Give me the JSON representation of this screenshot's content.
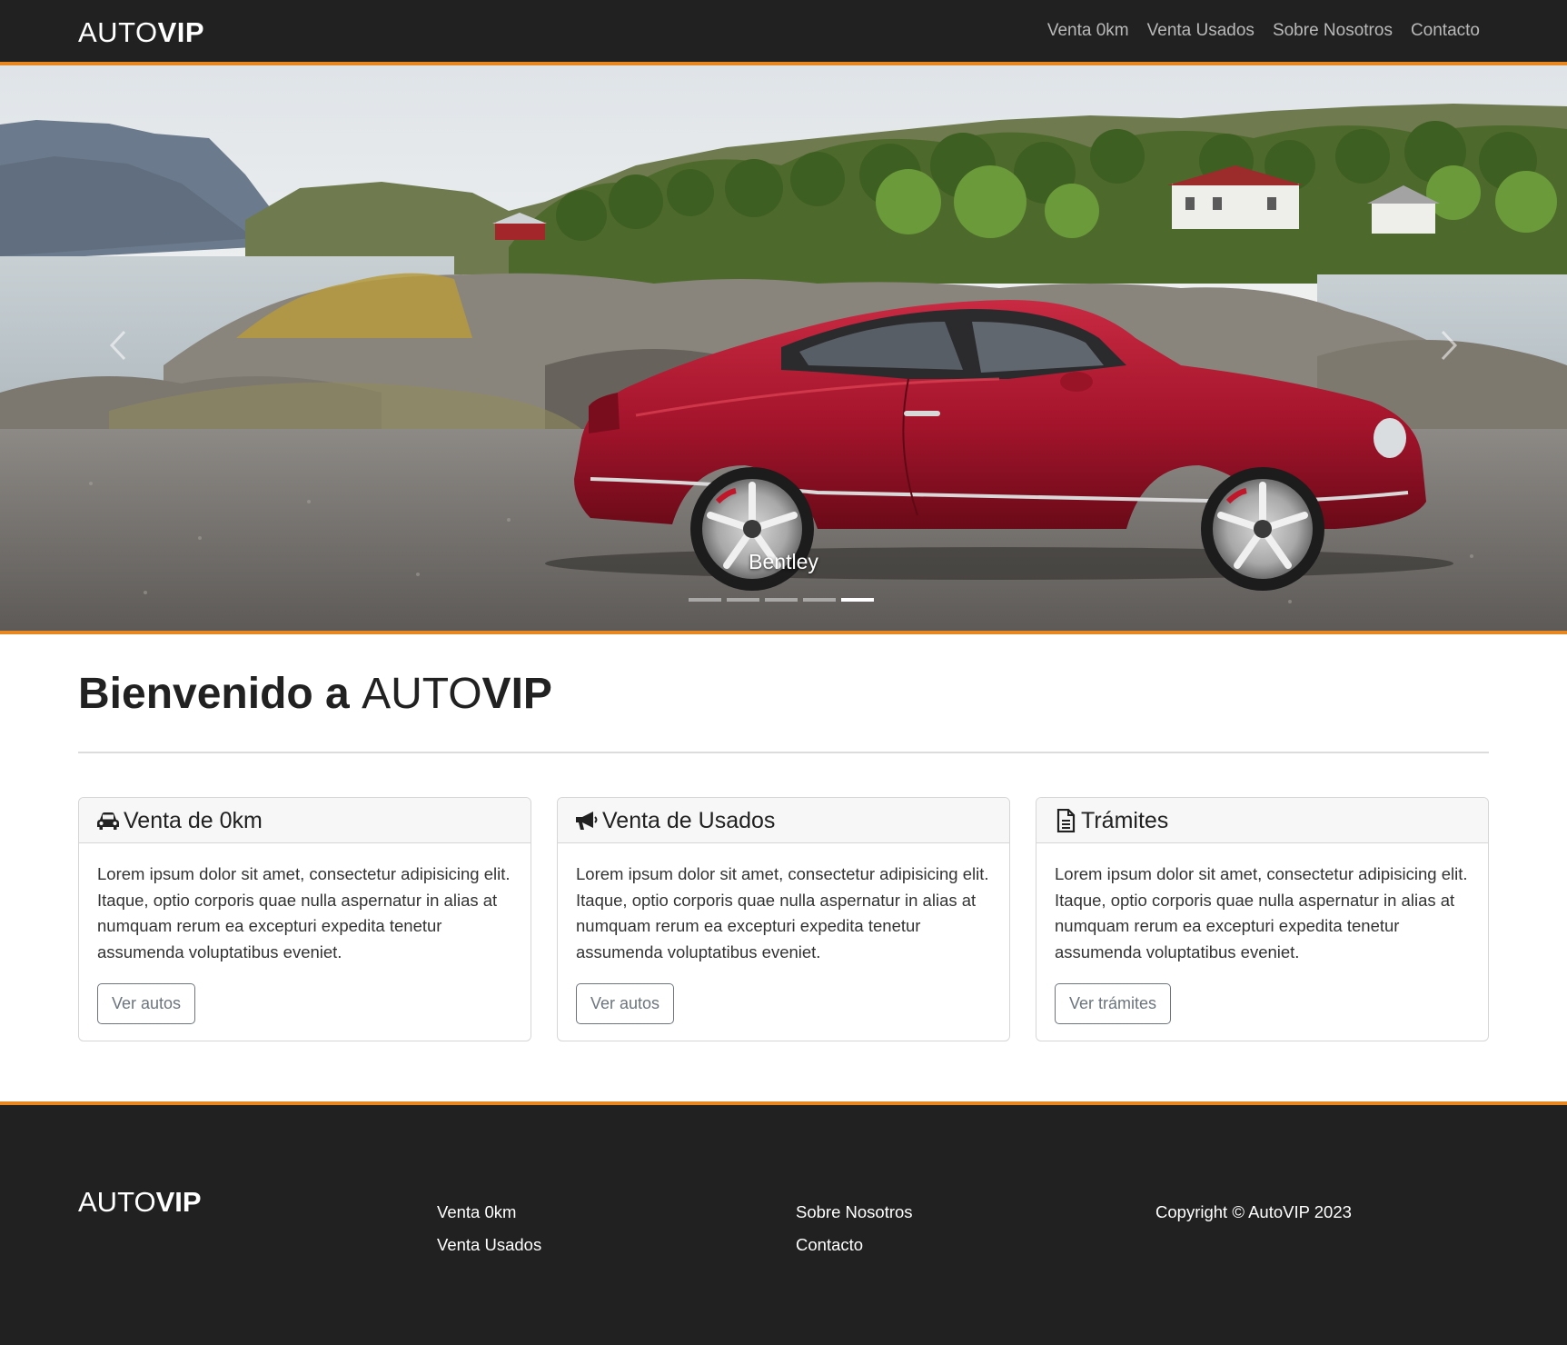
{
  "brand": {
    "light": "AUTO",
    "bold": "VIP"
  },
  "nav": {
    "items": [
      {
        "label": "Venta 0km"
      },
      {
        "label": "Venta Usados"
      },
      {
        "label": "Sobre Nosotros"
      },
      {
        "label": "Contacto"
      }
    ]
  },
  "carousel": {
    "caption": "Bentley",
    "slide_count": 5,
    "active_slide": 5
  },
  "main": {
    "heading_prefix": "Bienvenido a ",
    "heading_light": "AUTO",
    "heading_bold": "VIP",
    "cards": [
      {
        "icon": "car-icon",
        "title": "Venta de 0km",
        "text": "Lorem ipsum dolor sit amet, consectetur adipisicing elit. Itaque, optio corporis quae nulla aspernatur in alias at numquam rerum ea excepturi expedita tenetur assumenda voluptatibus eveniet.",
        "button": "Ver autos"
      },
      {
        "icon": "megaphone-icon",
        "title": "Venta de Usados",
        "text": "Lorem ipsum dolor sit amet, consectetur adipisicing elit. Itaque, optio corporis quae nulla aspernatur in alias at numquam rerum ea excepturi expedita tenetur assumenda voluptatibus eveniet.",
        "button": "Ver autos"
      },
      {
        "icon": "document-icon",
        "title": "Trámites",
        "text": "Lorem ipsum dolor sit amet, consectetur adipisicing elit. Itaque, optio corporis quae nulla aspernatur in alias at numquam rerum ea excepturi expedita tenetur assumenda voluptatibus eveniet.",
        "button": "Ver trámites"
      }
    ]
  },
  "footer": {
    "brand_light": "AUTO",
    "brand_bold": "VIP",
    "col1": [
      "Venta 0km",
      "Venta Usados"
    ],
    "col2": [
      "Sobre Nosotros",
      "Contacto"
    ],
    "copyright": "Copyright © AutoVIP 2023"
  },
  "colors": {
    "accent": "#e8861f",
    "navbar_bg": "#212121",
    "car_red": "#b0182e"
  }
}
